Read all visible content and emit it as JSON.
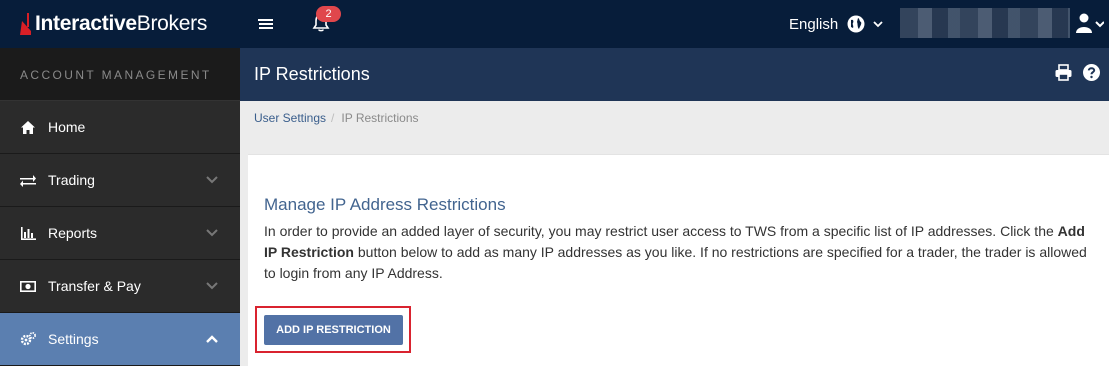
{
  "colors": {
    "topbar": "#071d3a",
    "page_header": "#1f3556",
    "sidebar": "#2b2b2b",
    "active_nav": "#5b7fb0",
    "accent_red": "#e0474c",
    "button": "#5272a6",
    "highlight_box": "#d9232f"
  },
  "header": {
    "logo_bold": "Interactive",
    "logo_light": "Brokers",
    "notification_count": "2",
    "language": "English"
  },
  "sidebar": {
    "section_title": "ACCOUNT MANAGEMENT",
    "items": [
      {
        "label": "Home",
        "icon": "home-icon"
      },
      {
        "label": "Trading",
        "icon": "exchange-arrows-icon"
      },
      {
        "label": "Reports",
        "icon": "bar-chart-icon"
      },
      {
        "label": "Transfer & Pay",
        "icon": "money-icon"
      },
      {
        "label": "Settings",
        "icon": "cogs-icon"
      }
    ]
  },
  "page": {
    "title": "IP Restrictions",
    "breadcrumb": {
      "parent": "User Settings",
      "separator": "/",
      "current": "IP Restrictions"
    },
    "section_title": "Manage IP Address Restrictions",
    "description": {
      "part1": "In order to provide an added layer of security, you may restrict user access to TWS from a specific list of IP addresses. Click the ",
      "bold": "Add IP Restriction",
      "part2": " button below to add as many IP addresses as you like. If no restrictions are specified for a trader, the trader is allowed to login from any IP Address."
    },
    "add_button_label": "ADD IP RESTRICTION"
  }
}
